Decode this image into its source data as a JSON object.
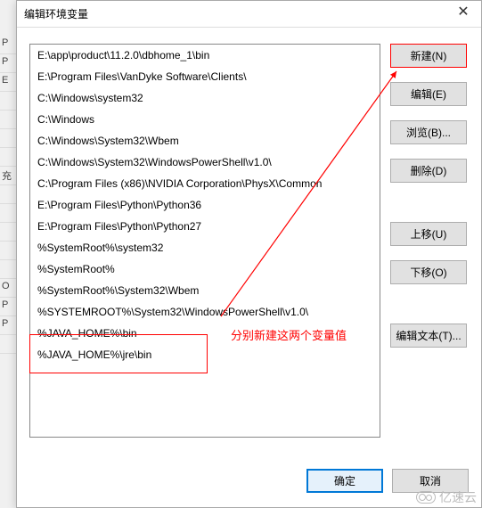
{
  "bg_items": [
    "P",
    "P",
    "E",
    "",
    "",
    "",
    "",
    "充",
    "",
    "",
    "",
    "",
    "",
    "O",
    "P",
    "P",
    ""
  ],
  "dialog": {
    "title": "编辑环境变量",
    "close": "✕"
  },
  "paths": [
    "E:\\app\\product\\11.2.0\\dbhome_1\\bin",
    "E:\\Program Files\\VanDyke Software\\Clients\\",
    "C:\\Windows\\system32",
    "C:\\Windows",
    "C:\\Windows\\System32\\Wbem",
    "C:\\Windows\\System32\\WindowsPowerShell\\v1.0\\",
    "C:\\Program Files (x86)\\NVIDIA Corporation\\PhysX\\Common",
    "E:\\Program Files\\Python\\Python36",
    "E:\\Program Files\\Python\\Python27",
    "%SystemRoot%\\system32",
    "%SystemRoot%",
    "%SystemRoot%\\System32\\Wbem",
    "%SYSTEMROOT%\\System32\\WindowsPowerShell\\v1.0\\",
    "%JAVA_HOME%\\bin",
    "%JAVA_HOME%\\jre\\bin"
  ],
  "buttons": {
    "new": "新建(N)",
    "edit": "编辑(E)",
    "browse": "浏览(B)...",
    "delete": "删除(D)",
    "moveup": "上移(U)",
    "movedown": "下移(O)",
    "edittext": "编辑文本(T)...",
    "ok": "确定",
    "cancel": "取消"
  },
  "annotation": "分别新建这两个变量值",
  "watermark": "亿速云"
}
